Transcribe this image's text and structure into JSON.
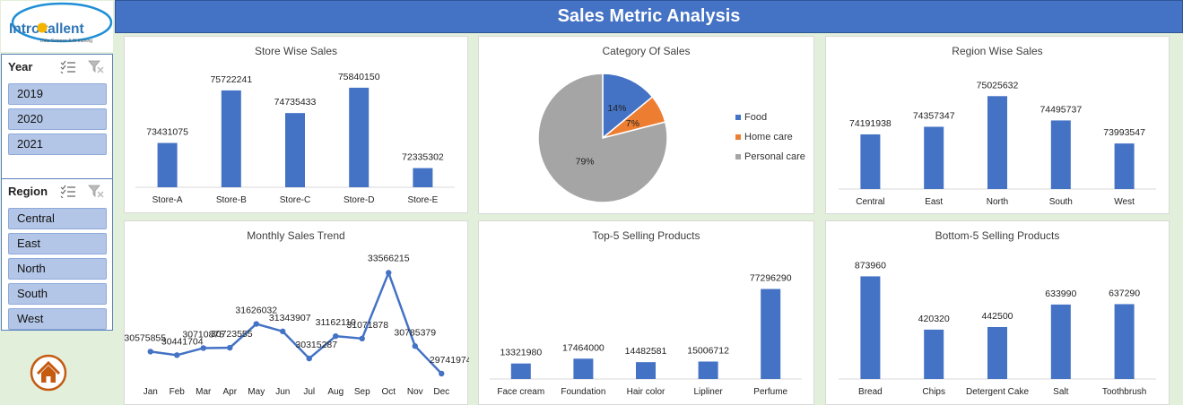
{
  "header": {
    "title": "Sales Metric Analysis"
  },
  "logo": {
    "brand": "Introtallent",
    "tagline": "Data Science & AI training"
  },
  "filters": {
    "year": {
      "title": "Year",
      "items": [
        "2019",
        "2020",
        "2021"
      ]
    },
    "region": {
      "title": "Region",
      "items": [
        "Central",
        "East",
        "North",
        "South",
        "West"
      ]
    }
  },
  "colors": {
    "bar": "#4472c4",
    "food": "#4472c4",
    "home_care": "#ed7d31",
    "personal_care": "#a5a5a5",
    "header": "#4472c4"
  },
  "chart_data": [
    {
      "id": "store",
      "type": "bar",
      "title": "Store Wise Sales",
      "categories": [
        "Store-A",
        "Store-B",
        "Store-C",
        "Store-D",
        "Store-E"
      ],
      "values": [
        73431075,
        75722241,
        74735433,
        75840150,
        72335302
      ],
      "labels": [
        "73431075",
        "75722241",
        "74735433",
        "75840150",
        "72335302"
      ],
      "ylim": [
        71500000,
        76500000
      ],
      "grid": false
    },
    {
      "id": "category",
      "type": "pie",
      "title": "Category Of Sales",
      "categories": [
        "Food",
        "Home care",
        "Personal care"
      ],
      "values": [
        14,
        7,
        79
      ],
      "labels": [
        "14%",
        "7%",
        "79%"
      ],
      "legend": "right"
    },
    {
      "id": "region",
      "type": "bar",
      "title": "Region Wise Sales",
      "categories": [
        "Central",
        "East",
        "North",
        "South",
        "West"
      ],
      "values": [
        74191938,
        74357347,
        75025632,
        74495737,
        73993547
      ],
      "labels": [
        "74191938",
        "74357347",
        "75025632",
        "74495737",
        "73993547"
      ],
      "ylim": [
        73000000,
        75500000
      ],
      "grid": false
    },
    {
      "id": "monthly",
      "type": "line",
      "title": "Monthly Sales Trend",
      "categories": [
        "Jan",
        "Feb",
        "Mar",
        "Apr",
        "May",
        "Jun",
        "Jul",
        "Aug",
        "Sep",
        "Oct",
        "Nov",
        "Dec"
      ],
      "values": [
        30575855,
        30441704,
        30710875,
        30723555,
        31626032,
        31343907,
        30315287,
        31162110,
        31071878,
        33566215,
        30785379,
        29741974
      ],
      "labels": [
        "30575855",
        "30441704",
        "30710875",
        "30723555",
        "31626032",
        "31343907",
        "30315287",
        "31162110",
        "31071878",
        "33566215",
        "30785379",
        "29741974"
      ],
      "ylim": [
        29400000,
        34500000
      ],
      "grid": false
    },
    {
      "id": "top5",
      "type": "bar",
      "title": "Top-5 Selling Products",
      "categories": [
        "Face cream",
        "Foundation",
        "Hair color",
        "Lipliner",
        "Perfume"
      ],
      "values": [
        13321980,
        17464000,
        14482581,
        15006712,
        77296290
      ],
      "labels": [
        "13321980",
        "17464000",
        "14482581",
        "15006712",
        "77296290"
      ],
      "ylim": [
        0,
        80000000
      ],
      "grid": false
    },
    {
      "id": "bottom5",
      "type": "bar",
      "title": "Bottom-5 Selling Products",
      "categories": [
        "Bread",
        "Chips",
        "Detergent Cake",
        "Salt",
        "Toothbrush"
      ],
      "values": [
        873960,
        420320,
        442500,
        633990,
        637290
      ],
      "labels": [
        "873960",
        "420320",
        "442500",
        "633990",
        "637290"
      ],
      "ylim": [
        0,
        900000
      ],
      "grid": false
    }
  ]
}
